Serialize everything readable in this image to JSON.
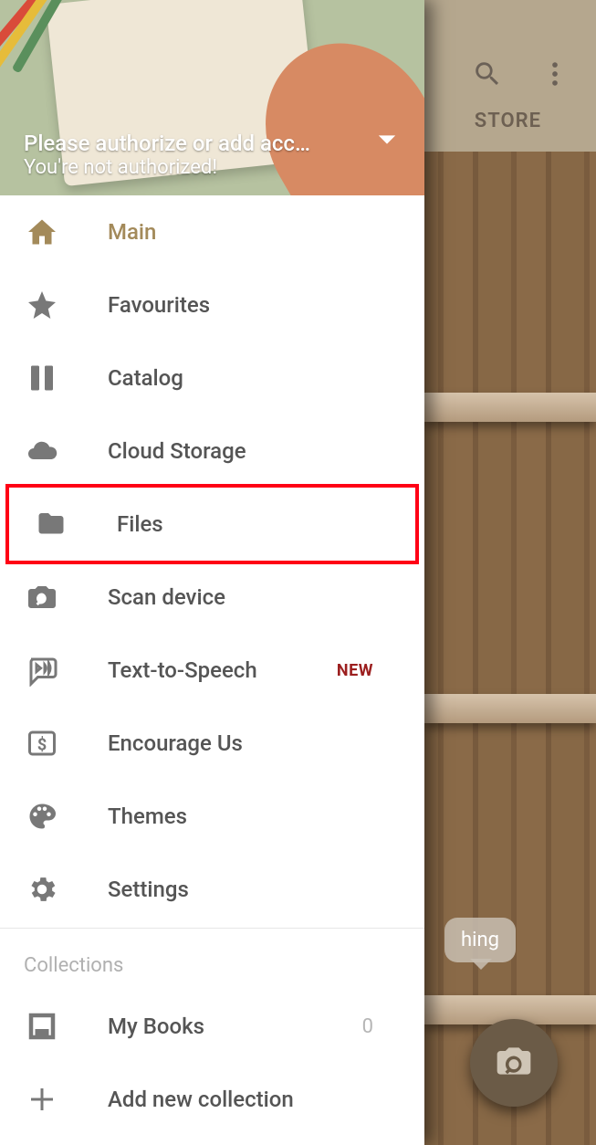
{
  "toolbar": {
    "store_label": "STORE"
  },
  "speech_text": "hing",
  "drawer": {
    "header": {
      "line1": "Please authorize or add acco…",
      "line2": "You're not authorized!"
    },
    "nav": {
      "main": "Main",
      "favourites": "Favourites",
      "catalog": "Catalog",
      "cloud_storage": "Cloud Storage",
      "files": "Files",
      "scan_device": "Scan device",
      "tts": "Text-to-Speech",
      "tts_badge": "NEW",
      "encourage": "Encourage Us",
      "themes": "Themes",
      "settings": "Settings"
    },
    "collections": {
      "title": "Collections",
      "my_books": "My Books",
      "my_books_count": "0",
      "add_new": "Add new collection"
    }
  }
}
